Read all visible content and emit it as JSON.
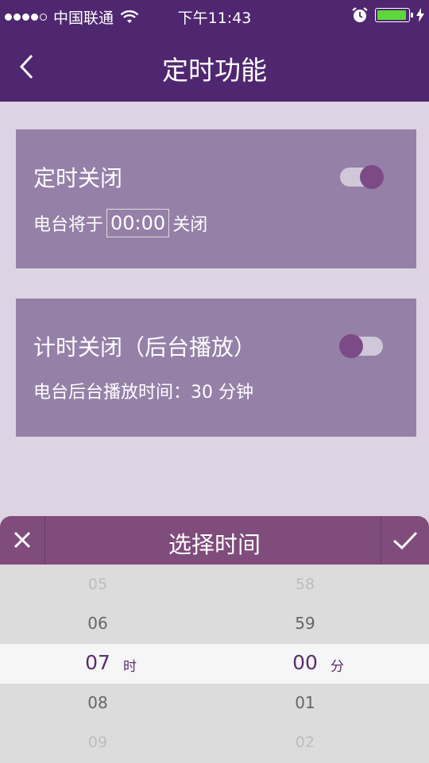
{
  "status_bar": {
    "signal_dots": 5,
    "carrier": "中国联通",
    "time": "下午11:43",
    "battery_level": 0.95
  },
  "nav": {
    "title": "定时功能",
    "back_icon": "chevron-left-icon"
  },
  "timer_close": {
    "title": "定时关闭",
    "desc_prefix": "电台将于",
    "time": "00:00",
    "desc_suffix": "关闭",
    "enabled": true
  },
  "countdown_close": {
    "title": "计时关闭（后台播放）",
    "desc": "电台后台播放时间：30 分钟",
    "enabled": false
  },
  "picker": {
    "title": "选择时间",
    "close_icon": "close-icon",
    "confirm_icon": "checkmark-icon",
    "hours": [
      "05",
      "06",
      "07",
      "08",
      "09"
    ],
    "minutes": [
      "58",
      "59",
      "00",
      "01",
      "02"
    ],
    "hour_unit": "时",
    "minute_unit": "分",
    "selected_index": 2
  },
  "colors": {
    "primary": "#4f2770",
    "card": "#9580a8",
    "picker_header": "#7f4c7b",
    "battery": "#5cd83b"
  }
}
